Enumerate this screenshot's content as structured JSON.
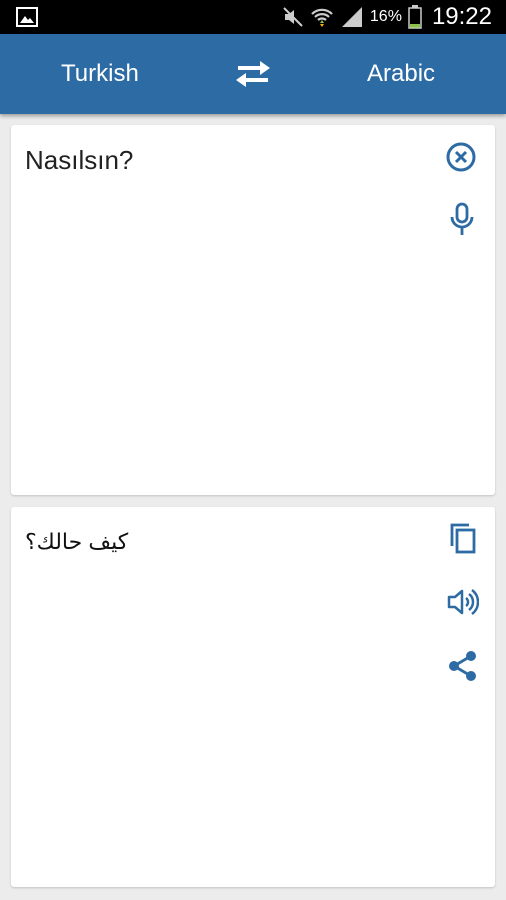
{
  "status_bar": {
    "battery_percent": "16%",
    "time": "19:22",
    "icons": [
      "gallery-icon",
      "mute-icon",
      "wifi-icon",
      "signal-icon",
      "battery-icon"
    ]
  },
  "app_bar": {
    "source_language": "Turkish",
    "target_language": "Arabic",
    "swap_icon": "swap-arrows-icon",
    "background_color": "#2d6ba4"
  },
  "input_card": {
    "text": "Nasılsın?",
    "icons": [
      "clear-icon",
      "mic-icon"
    ]
  },
  "output_card": {
    "text": "كيف حالك؟",
    "icons": [
      "copy-icon",
      "speaker-icon",
      "share-icon"
    ]
  },
  "accent_color": "#2d6ba4"
}
